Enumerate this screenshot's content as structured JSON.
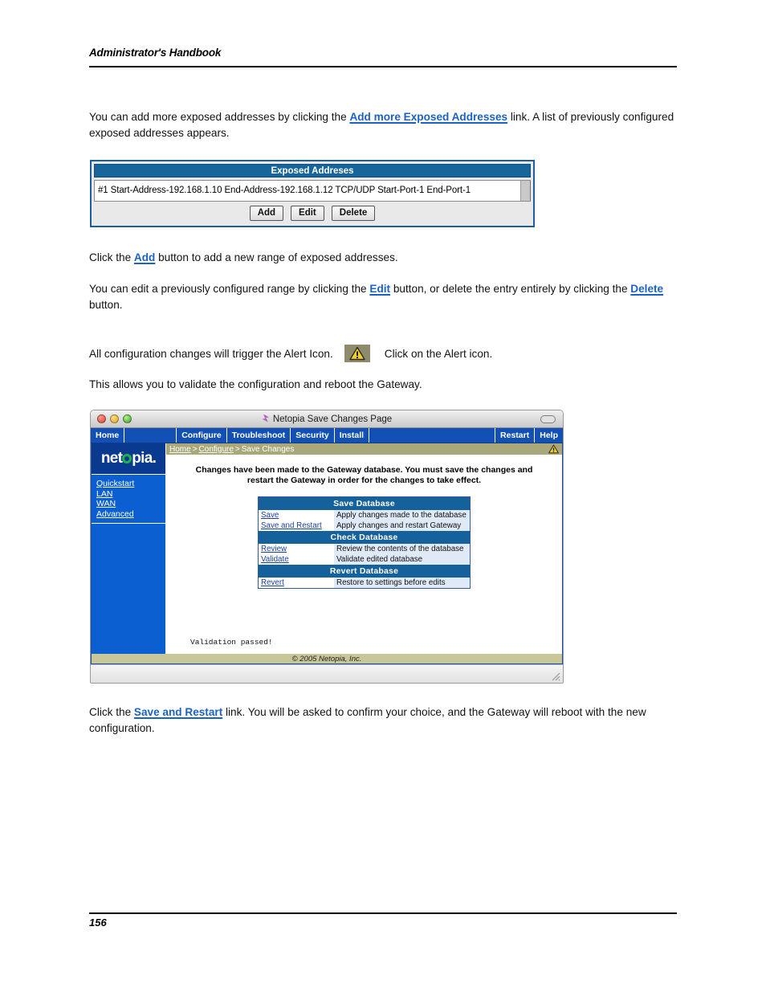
{
  "page": {
    "running_head": "Administrator's Handbook",
    "folio": "156"
  },
  "paragraphs": {
    "p1_a": "You can add more exposed addresses by clicking the ",
    "p1_link": "Add more Exposed Addresses",
    "p1_b": " link. A list of previously configured exposed addresses appears.",
    "p2_a": "Click the ",
    "p2_link": "Add",
    "p2_b": " button to add a new range of exposed addresses.",
    "p3_a": "You can edit a previously configured range by clicking the ",
    "p3_link1": "Edit",
    "p3_b": " button, or delete the entry entirely by clicking the ",
    "p3_link2": "Delete",
    "p3_c": " button.",
    "p_alert_a": "All configuration changes will trigger the Alert Icon.",
    "p_alert_b": "Click on the Alert icon.",
    "p_allows": "This allows you to validate the configuration and reboot the Gateway.",
    "p_last_a": "Click the ",
    "p_last_link": "Save and Restart",
    "p_last_b": " link. You will be asked to confirm your choice, and the Gateway will reboot with the new configuration."
  },
  "exposed_figure": {
    "title": "Exposed Addreses",
    "entries": [
      "#1 Start-Address-192.168.1.10 End-Address-192.168.1.12 TCP/UDP Start-Port-1 End-Port-1"
    ],
    "buttons": {
      "add": "Add",
      "edit": "Edit",
      "delete": "Delete"
    }
  },
  "browser": {
    "window_title": "Netopia Save Changes Page",
    "nav": {
      "home": "Home",
      "configure": "Configure",
      "troubleshoot": "Troubleshoot",
      "security": "Security",
      "install": "Install",
      "restart": "Restart",
      "help": "Help"
    },
    "sidebar": {
      "logo_pre": "net",
      "logo_post": "pia.",
      "items": [
        {
          "label": "Quickstart"
        },
        {
          "label": "LAN"
        },
        {
          "label": "WAN"
        },
        {
          "label": "Advanced"
        }
      ]
    },
    "breadcrumb": {
      "home": "Home",
      "configure": "Configure",
      "current": "Save Changes",
      "sep": ">"
    },
    "notice_line1": "Changes have been made to the Gateway database. You must save the changes and",
    "notice_line2": "restart the Gateway in order for the changes to take effect.",
    "db_table": {
      "sections": [
        {
          "header": "Save Database",
          "rows": [
            {
              "link": "Save",
              "desc": "Apply changes made to the database"
            },
            {
              "link": "Save and Restart",
              "desc": "Apply changes and restart Gateway"
            }
          ]
        },
        {
          "header": "Check Database",
          "rows": [
            {
              "link": "Review",
              "desc": "Review the contents of the database"
            },
            {
              "link": "Validate",
              "desc": "Validate edited database"
            }
          ]
        },
        {
          "header": "Revert Database",
          "rows": [
            {
              "link": "Revert",
              "desc": "Restore to settings before edits"
            }
          ]
        }
      ]
    },
    "validation_message": "Validation passed!",
    "footer": "© 2005 Netopia, Inc."
  },
  "colors": {
    "link_blue": "#1c62c4",
    "netopia_blue": "#0b5fd0",
    "navy": "#0a3a8f",
    "table_header_blue": "#15619b",
    "khaki": "#a9a87a",
    "footer_khaki": "#c8c79a",
    "logo_green": "#22b14c",
    "alert_yellow": "#f2d024"
  }
}
